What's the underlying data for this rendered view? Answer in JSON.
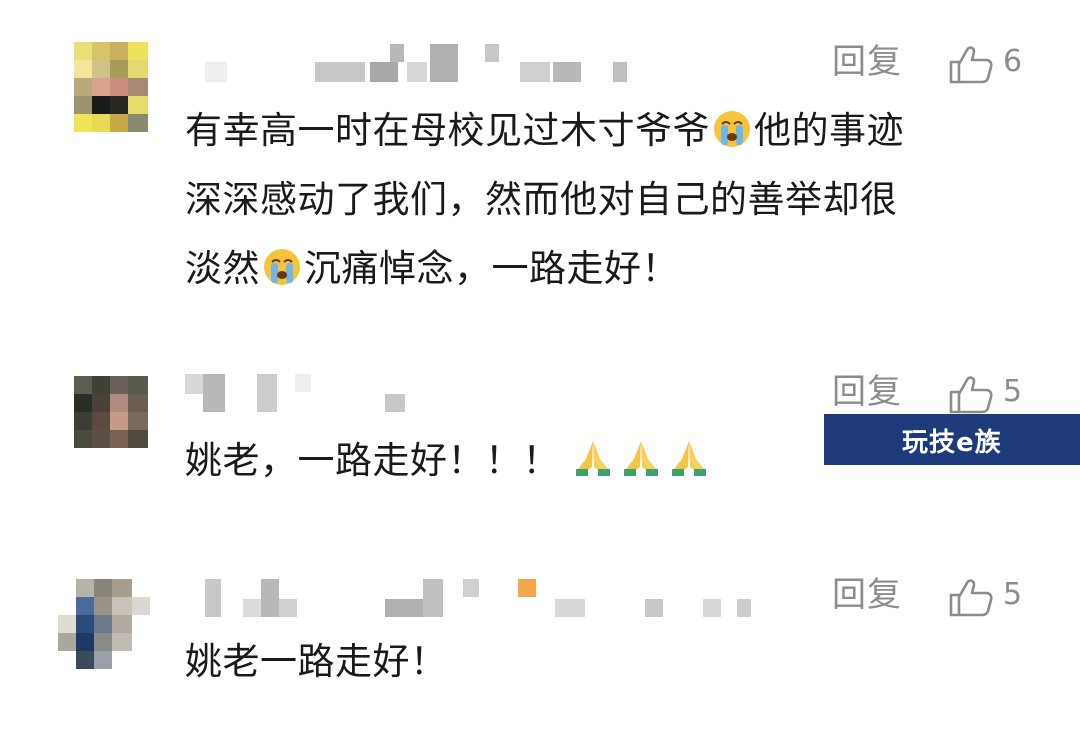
{
  "comments": [
    {
      "reply_label": "回复",
      "like_count": "6",
      "lines": [
        "有幸高一时在母校见过木寸爷爷",
        "他的事迹",
        "深深感动了我们，然而他对自己的善举却很",
        "淡然",
        "沉痛悼念，一路走好！"
      ]
    },
    {
      "reply_label": "回复",
      "like_count": "5",
      "lines": [
        "姚老，一路走好！！！"
      ]
    },
    {
      "reply_label": "回复",
      "like_count": "5",
      "lines": [
        "姚老一路走好！"
      ]
    }
  ],
  "watermark": "玩技e族",
  "icons": {
    "like": "thumbs-up-icon",
    "cry": "crying-face-emoji",
    "pray": "folded-hands-emoji"
  },
  "colors": {
    "text": "#1a1a1a",
    "meta": "#8c8c8c",
    "watermark_bg": "#1f3a7a"
  }
}
